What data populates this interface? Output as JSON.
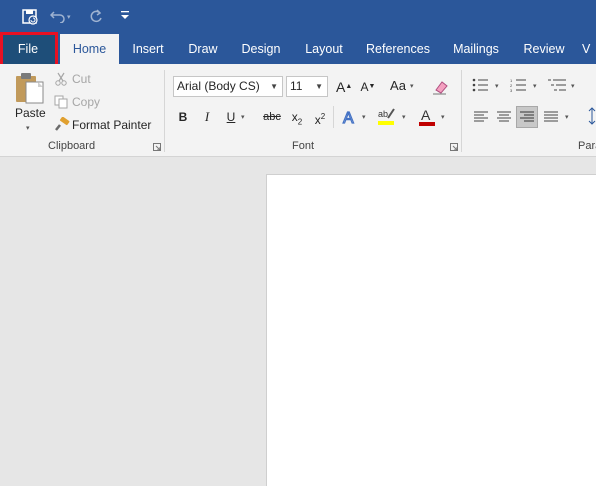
{
  "qat": {
    "save_icon": "save-icon",
    "undo_icon": "undo-icon",
    "redo_icon": "redo-icon",
    "customize_icon": "customize-qat-icon"
  },
  "tabs": {
    "file": "File",
    "home": "Home",
    "insert": "Insert",
    "draw": "Draw",
    "design": "Design",
    "layout": "Layout",
    "references": "References",
    "mailings": "Mailings",
    "review": "Review",
    "view_partial": "V"
  },
  "clipboard": {
    "paste": "Paste",
    "cut": "Cut",
    "copy": "Copy",
    "format_painter": "Format Painter",
    "group_label": "Clipboard"
  },
  "font": {
    "font_name": "Arial (Body CS)",
    "font_size": "11",
    "bold": "B",
    "italic": "I",
    "underline": "U",
    "strikethrough": "abc",
    "subscript": "x",
    "subscript_mark": "2",
    "superscript": "x",
    "superscript_mark": "2",
    "grow_font": "A",
    "shrink_font": "A",
    "change_case": "Aa",
    "group_label": "Font",
    "highlight_color": "#ffff00",
    "font_color": "#c00000"
  },
  "paragraph": {
    "group_label_partial": "Para"
  },
  "colors": {
    "brand": "#2b579a",
    "file_highlight": "#e81123"
  }
}
